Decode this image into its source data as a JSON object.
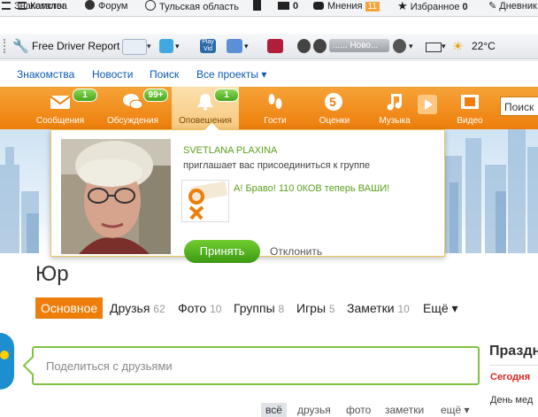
{
  "browser_toolbar": {
    "items": [
      "Знакомства",
      "Каталог",
      "Форум",
      "Тульская область",
      "0",
      "Мнения",
      "11",
      "Избранное",
      "0",
      "Дневник"
    ],
    "driver_report": "Free Driver Report",
    "radio_station": "...... Ново...",
    "weather": "22°C"
  },
  "site_nav": {
    "links": [
      "Знакомства",
      "Новости",
      "Поиск",
      "Все проекты ▾"
    ]
  },
  "orange_bar": {
    "items": [
      {
        "label": "Сообщения",
        "badge": "1"
      },
      {
        "label": "Обсуждения",
        "badge": "99+"
      },
      {
        "label": "Оповещения",
        "badge": "1"
      },
      {
        "label": "Гости",
        "badge": ""
      },
      {
        "label": "Оценки",
        "badge": ""
      },
      {
        "label": "Музыка",
        "badge": ""
      },
      {
        "label": "Видео",
        "badge": ""
      }
    ],
    "search_placeholder": "Поиск"
  },
  "notification": {
    "sender": "SVETLANA PLAXINA",
    "message": "приглашает вас присоединиться к группе",
    "group_title": "А! Браво! 110 0КОВ теперь ВАШИ!",
    "accept_label": "Принять",
    "decline_label": "Отклонить"
  },
  "profile": {
    "name": "Юр",
    "tabs": [
      {
        "label": "Основное",
        "count": ""
      },
      {
        "label": "Друзья",
        "count": "62"
      },
      {
        "label": "Фото",
        "count": "10"
      },
      {
        "label": "Группы",
        "count": "8"
      },
      {
        "label": "Игры",
        "count": "5"
      },
      {
        "label": "Заметки",
        "count": "10"
      },
      {
        "label": "Ещё ▾",
        "count": ""
      }
    ],
    "share_placeholder": "Поделиться с друзьями",
    "filters": [
      "всё",
      "друзья",
      "фото",
      "заметки",
      "ещё ▾"
    ]
  },
  "right_column": {
    "title": "Праздн",
    "today": "Сегодня",
    "next": "День мед"
  },
  "colors": {
    "accent": "#ed7e0b",
    "link": "#0a59b6",
    "green": "#4aa61b"
  }
}
